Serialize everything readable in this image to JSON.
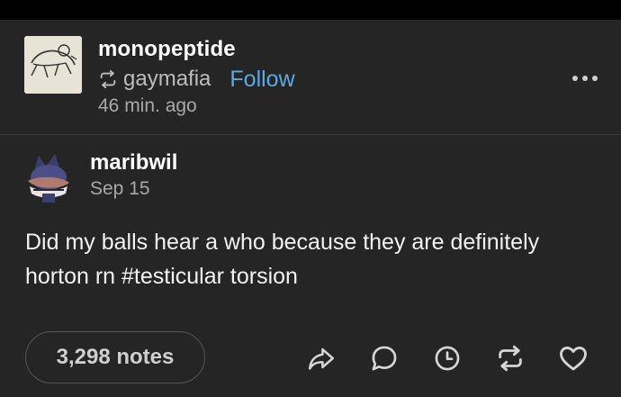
{
  "header": {
    "username": "monopeptide",
    "reblogged_from": "gaymafia",
    "follow_label": "Follow",
    "time_ago": "46 min. ago",
    "reblog_icon": "reblog-icon",
    "more_icon": "more-dots-icon"
  },
  "original_post": {
    "username": "maribwil",
    "date": "Sep 15",
    "body": "Did my balls hear a who because they are definitely horton rn #testicular torsion"
  },
  "footer": {
    "notes_label": "3,298 notes",
    "actions": [
      "share-icon",
      "reply-icon",
      "schedule-icon",
      "reblog-icon",
      "like-icon"
    ]
  },
  "colors": {
    "background": "#252525",
    "follow_link": "#5aa9e6",
    "text_primary": "#ffffff",
    "text_secondary": "#a9a9a9"
  }
}
